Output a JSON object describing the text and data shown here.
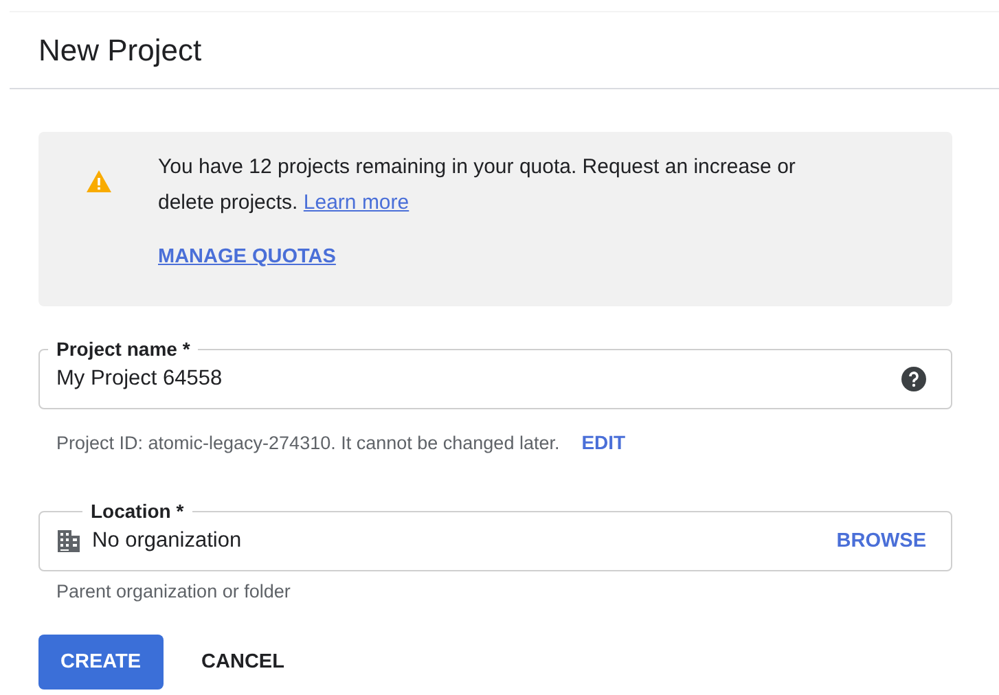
{
  "dialog": {
    "title": "New Project"
  },
  "notice": {
    "text": "You have 12 projects remaining in your quota. Request an increase or delete projects.",
    "link": "Learn more",
    "action": "MANAGE QUOTAS"
  },
  "fields": [
    {
      "kind": "text",
      "label": "Project name *",
      "value": "My Project 64558",
      "hint": "Project ID: atomic-legacy-274310. It cannot be changed later.",
      "hint_action": "EDIT"
    },
    {
      "kind": "location",
      "label": "Location *",
      "value": "No organization",
      "action": "BROWSE",
      "hint": "Parent organization or folder"
    }
  ],
  "buttons": [
    {
      "label": "CREATE",
      "primary": true
    },
    {
      "label": "CANCEL",
      "primary": false
    }
  ]
}
